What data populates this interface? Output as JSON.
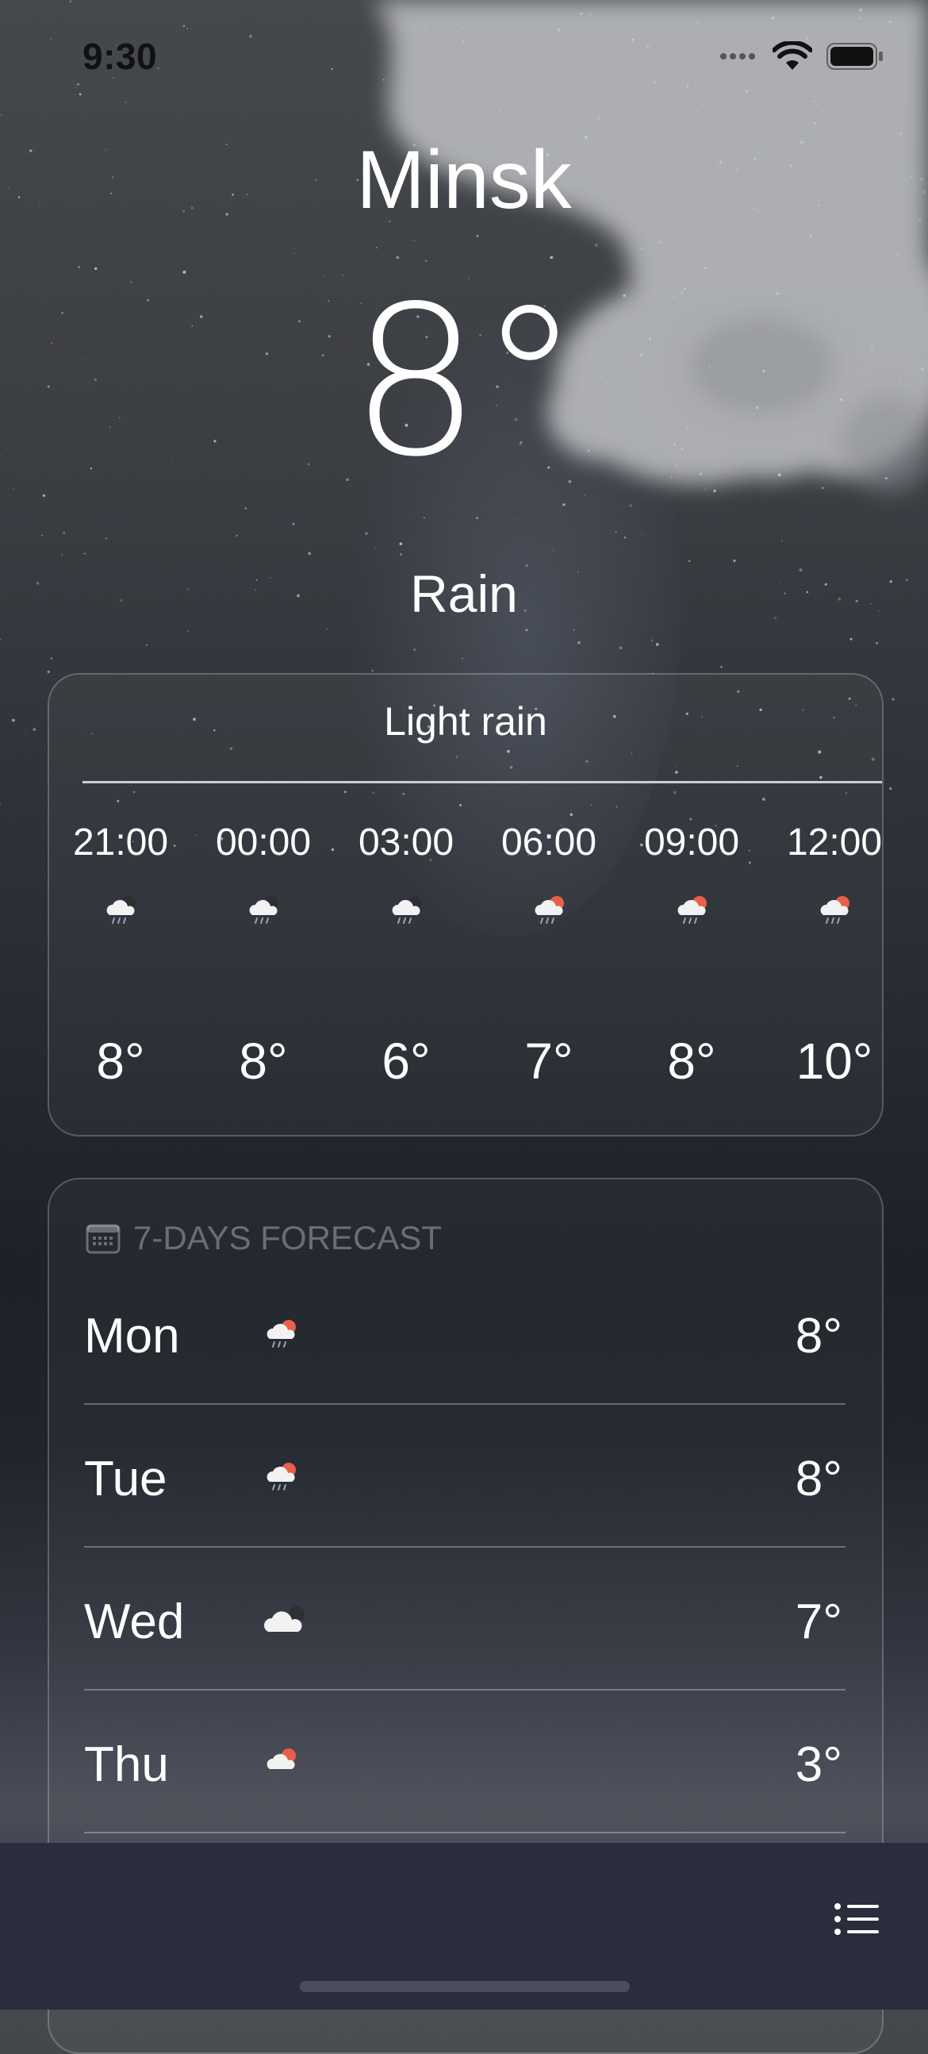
{
  "status_bar": {
    "time": "9:30"
  },
  "current": {
    "city": "Minsk",
    "temperature": "8°",
    "condition": "Rain"
  },
  "hourly": {
    "summary": "Light rain",
    "items": [
      {
        "time": "21:00",
        "icon": "cloud-rain-moon-icon",
        "temp": "8°"
      },
      {
        "time": "00:00",
        "icon": "cloud-rain-moon-icon",
        "temp": "8°"
      },
      {
        "time": "03:00",
        "icon": "cloud-rain-moon-icon",
        "temp": "6°"
      },
      {
        "time": "06:00",
        "icon": "cloud-rain-sun-icon",
        "temp": "7°"
      },
      {
        "time": "09:00",
        "icon": "cloud-rain-sun-icon",
        "temp": "8°"
      },
      {
        "time": "12:00",
        "icon": "cloud-rain-sun-icon",
        "temp": "10°"
      }
    ]
  },
  "forecast": {
    "header": "7-DAYS FORECAST",
    "days": [
      {
        "day": "Mon",
        "icon": "cloud-rain-sun-icon",
        "temp": "8°"
      },
      {
        "day": "Tue",
        "icon": "cloud-rain-sun-icon",
        "temp": "8°"
      },
      {
        "day": "Wed",
        "icon": "cloud-moon-icon",
        "temp": "7°"
      },
      {
        "day": "Thu",
        "icon": "cloud-sun-icon",
        "temp": "3°"
      }
    ]
  },
  "colors": {
    "sun": "#e8604a",
    "moon": "#2e2f33",
    "cloud": "#f2f2f2"
  }
}
